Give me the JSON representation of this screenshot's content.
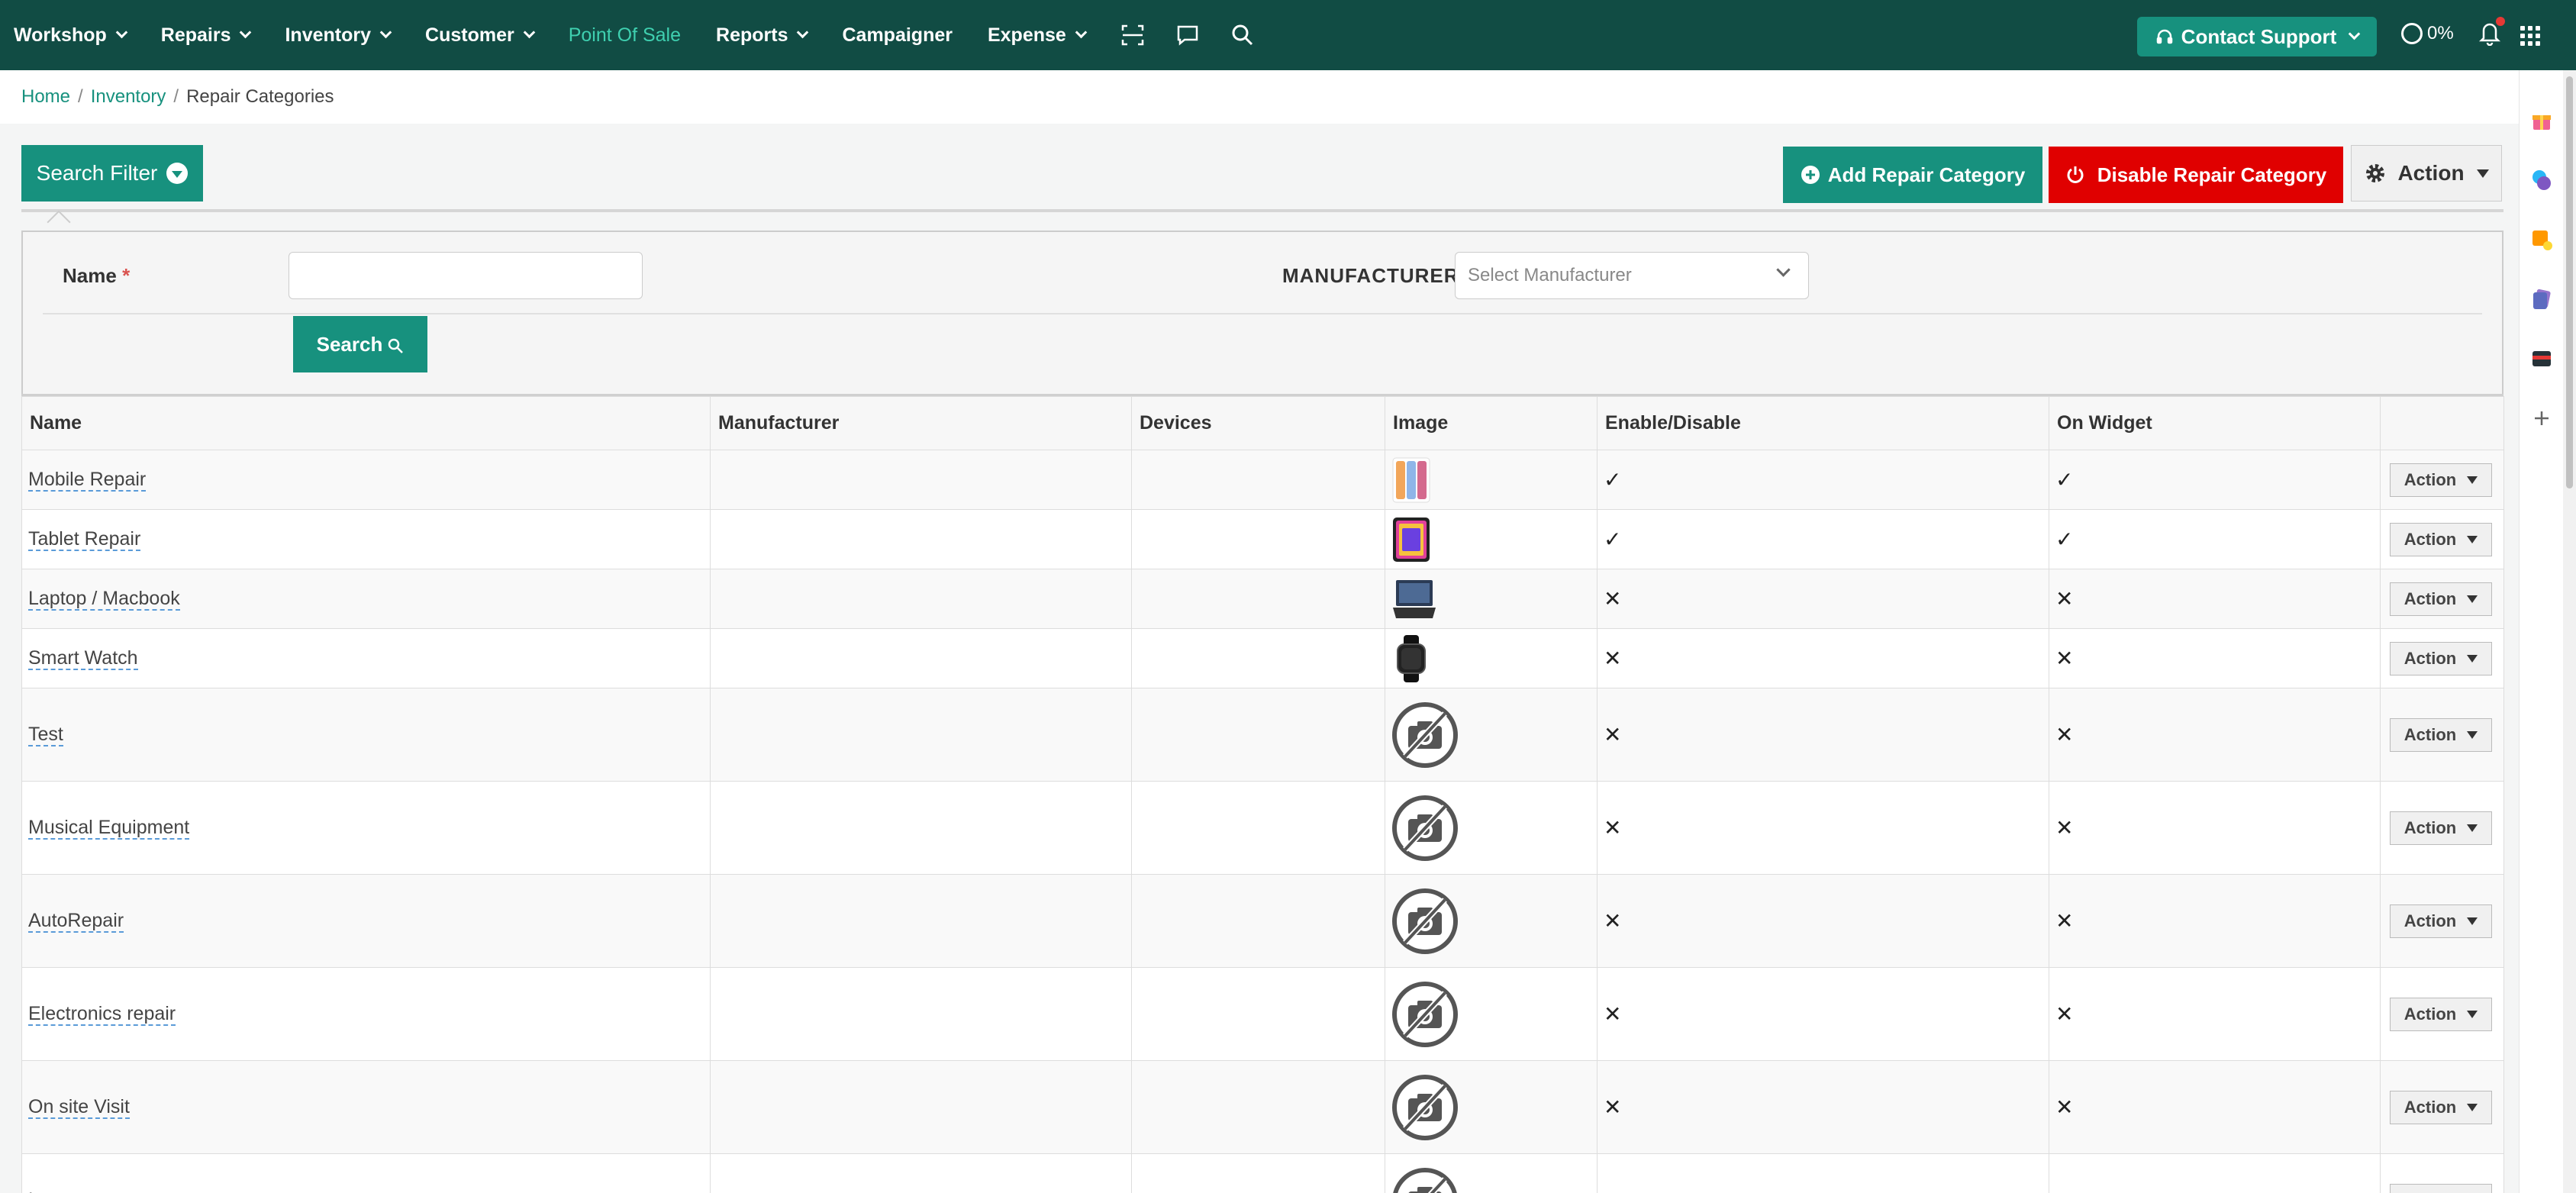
{
  "nav": {
    "items": [
      {
        "label": "Workshop",
        "dropdown": true
      },
      {
        "label": "Repairs",
        "dropdown": true
      },
      {
        "label": "Inventory",
        "dropdown": true
      },
      {
        "label": "Customer",
        "dropdown": true
      },
      {
        "label": "Point Of Sale",
        "dropdown": false,
        "active": true
      },
      {
        "label": "Reports",
        "dropdown": true
      },
      {
        "label": "Campaigner",
        "dropdown": false
      },
      {
        "label": "Expense",
        "dropdown": true
      }
    ],
    "support_label": "Contact Support",
    "progress_label": "0%"
  },
  "breadcrumb": {
    "home": "Home",
    "inventory": "Inventory",
    "current": "Repair Categories"
  },
  "toolbar": {
    "filter_label": "Search Filter",
    "add_label": "Add Repair Category",
    "disable_label": "Disable Repair Category",
    "action_label": "Action"
  },
  "filter": {
    "name_label": "Name",
    "required_mark": "*",
    "manufacturer_label": "MANUFACTURER",
    "manufacturer_placeholder": "Select Manufacturer",
    "search_label": "Search"
  },
  "table": {
    "headers": [
      "Name",
      "Manufacturer",
      "Devices",
      "Image",
      "Enable/Disable",
      "On Widget",
      ""
    ],
    "rows": [
      {
        "name": "Mobile Repair",
        "manufacturer": "",
        "devices": "",
        "image": "phone",
        "enable": "✓",
        "widget": "✓",
        "action": "Action"
      },
      {
        "name": "Tablet Repair",
        "manufacturer": "",
        "devices": "",
        "image": "tablet",
        "enable": "✓",
        "widget": "✓",
        "action": "Action"
      },
      {
        "name": "Laptop / Macbook",
        "manufacturer": "",
        "devices": "",
        "image": "laptop",
        "enable": "✕",
        "widget": "✕",
        "action": "Action"
      },
      {
        "name": "Smart Watch",
        "manufacturer": "",
        "devices": "",
        "image": "watch",
        "enable": "✕",
        "widget": "✕",
        "action": "Action"
      },
      {
        "name": "Test",
        "manufacturer": "",
        "devices": "",
        "image": "none",
        "enable": "✕",
        "widget": "✕",
        "action": "Action"
      },
      {
        "name": "Musical Equipment",
        "manufacturer": "",
        "devices": "",
        "image": "none",
        "enable": "✕",
        "widget": "✕",
        "action": "Action"
      },
      {
        "name": "AutoRepair",
        "manufacturer": "",
        "devices": "",
        "image": "none",
        "enable": "✕",
        "widget": "✕",
        "action": "Action"
      },
      {
        "name": "Electronics repair",
        "manufacturer": "",
        "devices": "",
        "image": "none",
        "enable": "✕",
        "widget": "✕",
        "action": "Action"
      },
      {
        "name": "On site Visit",
        "manufacturer": "",
        "devices": "",
        "image": "none",
        "enable": "✕",
        "widget": "✕",
        "action": "Action"
      },
      {
        "name": "Lens",
        "manufacturer": "",
        "devices": "",
        "image": "none",
        "enable": "✕",
        "widget": "✕",
        "action": "Action"
      }
    ]
  },
  "colors": {
    "nav_bg": "#114c44",
    "primary": "#17917e",
    "danger": "#e00000",
    "active_nav": "#3fd0b0"
  }
}
